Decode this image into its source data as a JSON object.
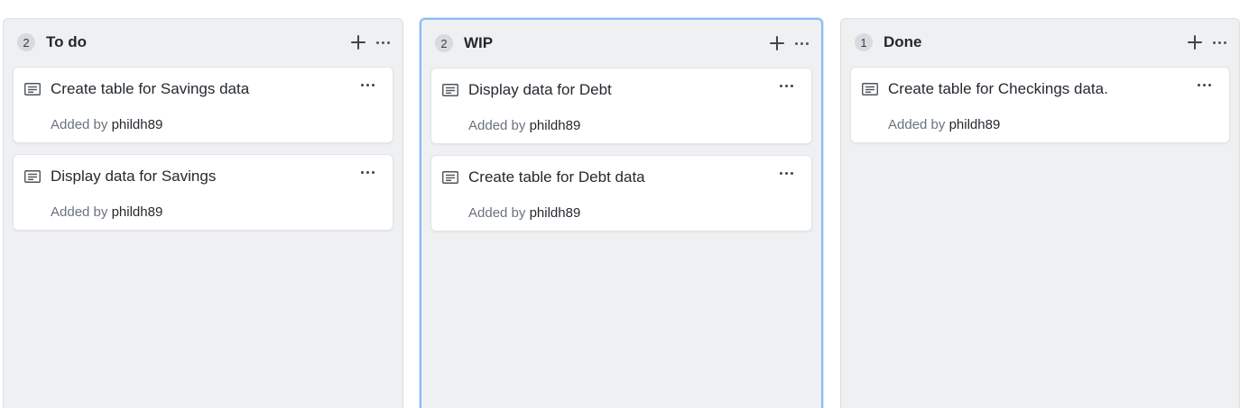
{
  "columns": [
    {
      "title": "To do",
      "count": "2",
      "cards": [
        {
          "title": "Create table for Savings data",
          "added_by_label": "Added by",
          "author": "phildh89"
        },
        {
          "title": "Display data for Savings",
          "added_by_label": "Added by",
          "author": "phildh89"
        }
      ]
    },
    {
      "title": "WIP",
      "count": "2",
      "selected": true,
      "cards": [
        {
          "title": "Display data for Debt",
          "added_by_label": "Added by",
          "author": "phildh89"
        },
        {
          "title": "Create table for Debt data",
          "added_by_label": "Added by",
          "author": "phildh89"
        }
      ]
    },
    {
      "title": "Done",
      "count": "1",
      "cards": [
        {
          "title": "Create table for Checkings data.",
          "added_by_label": "Added by",
          "author": "phildh89"
        }
      ]
    }
  ],
  "icons": {
    "column_add": "plus-icon",
    "column_menu": "kebab-horizontal-icon",
    "card_type": "note-icon",
    "card_menu": "kebab-horizontal-icon"
  },
  "colors": {
    "column_bg": "#eff0f2",
    "selected_border": "#8bbcf5",
    "card_bg": "#ffffff",
    "meta_text": "#6a737d"
  }
}
